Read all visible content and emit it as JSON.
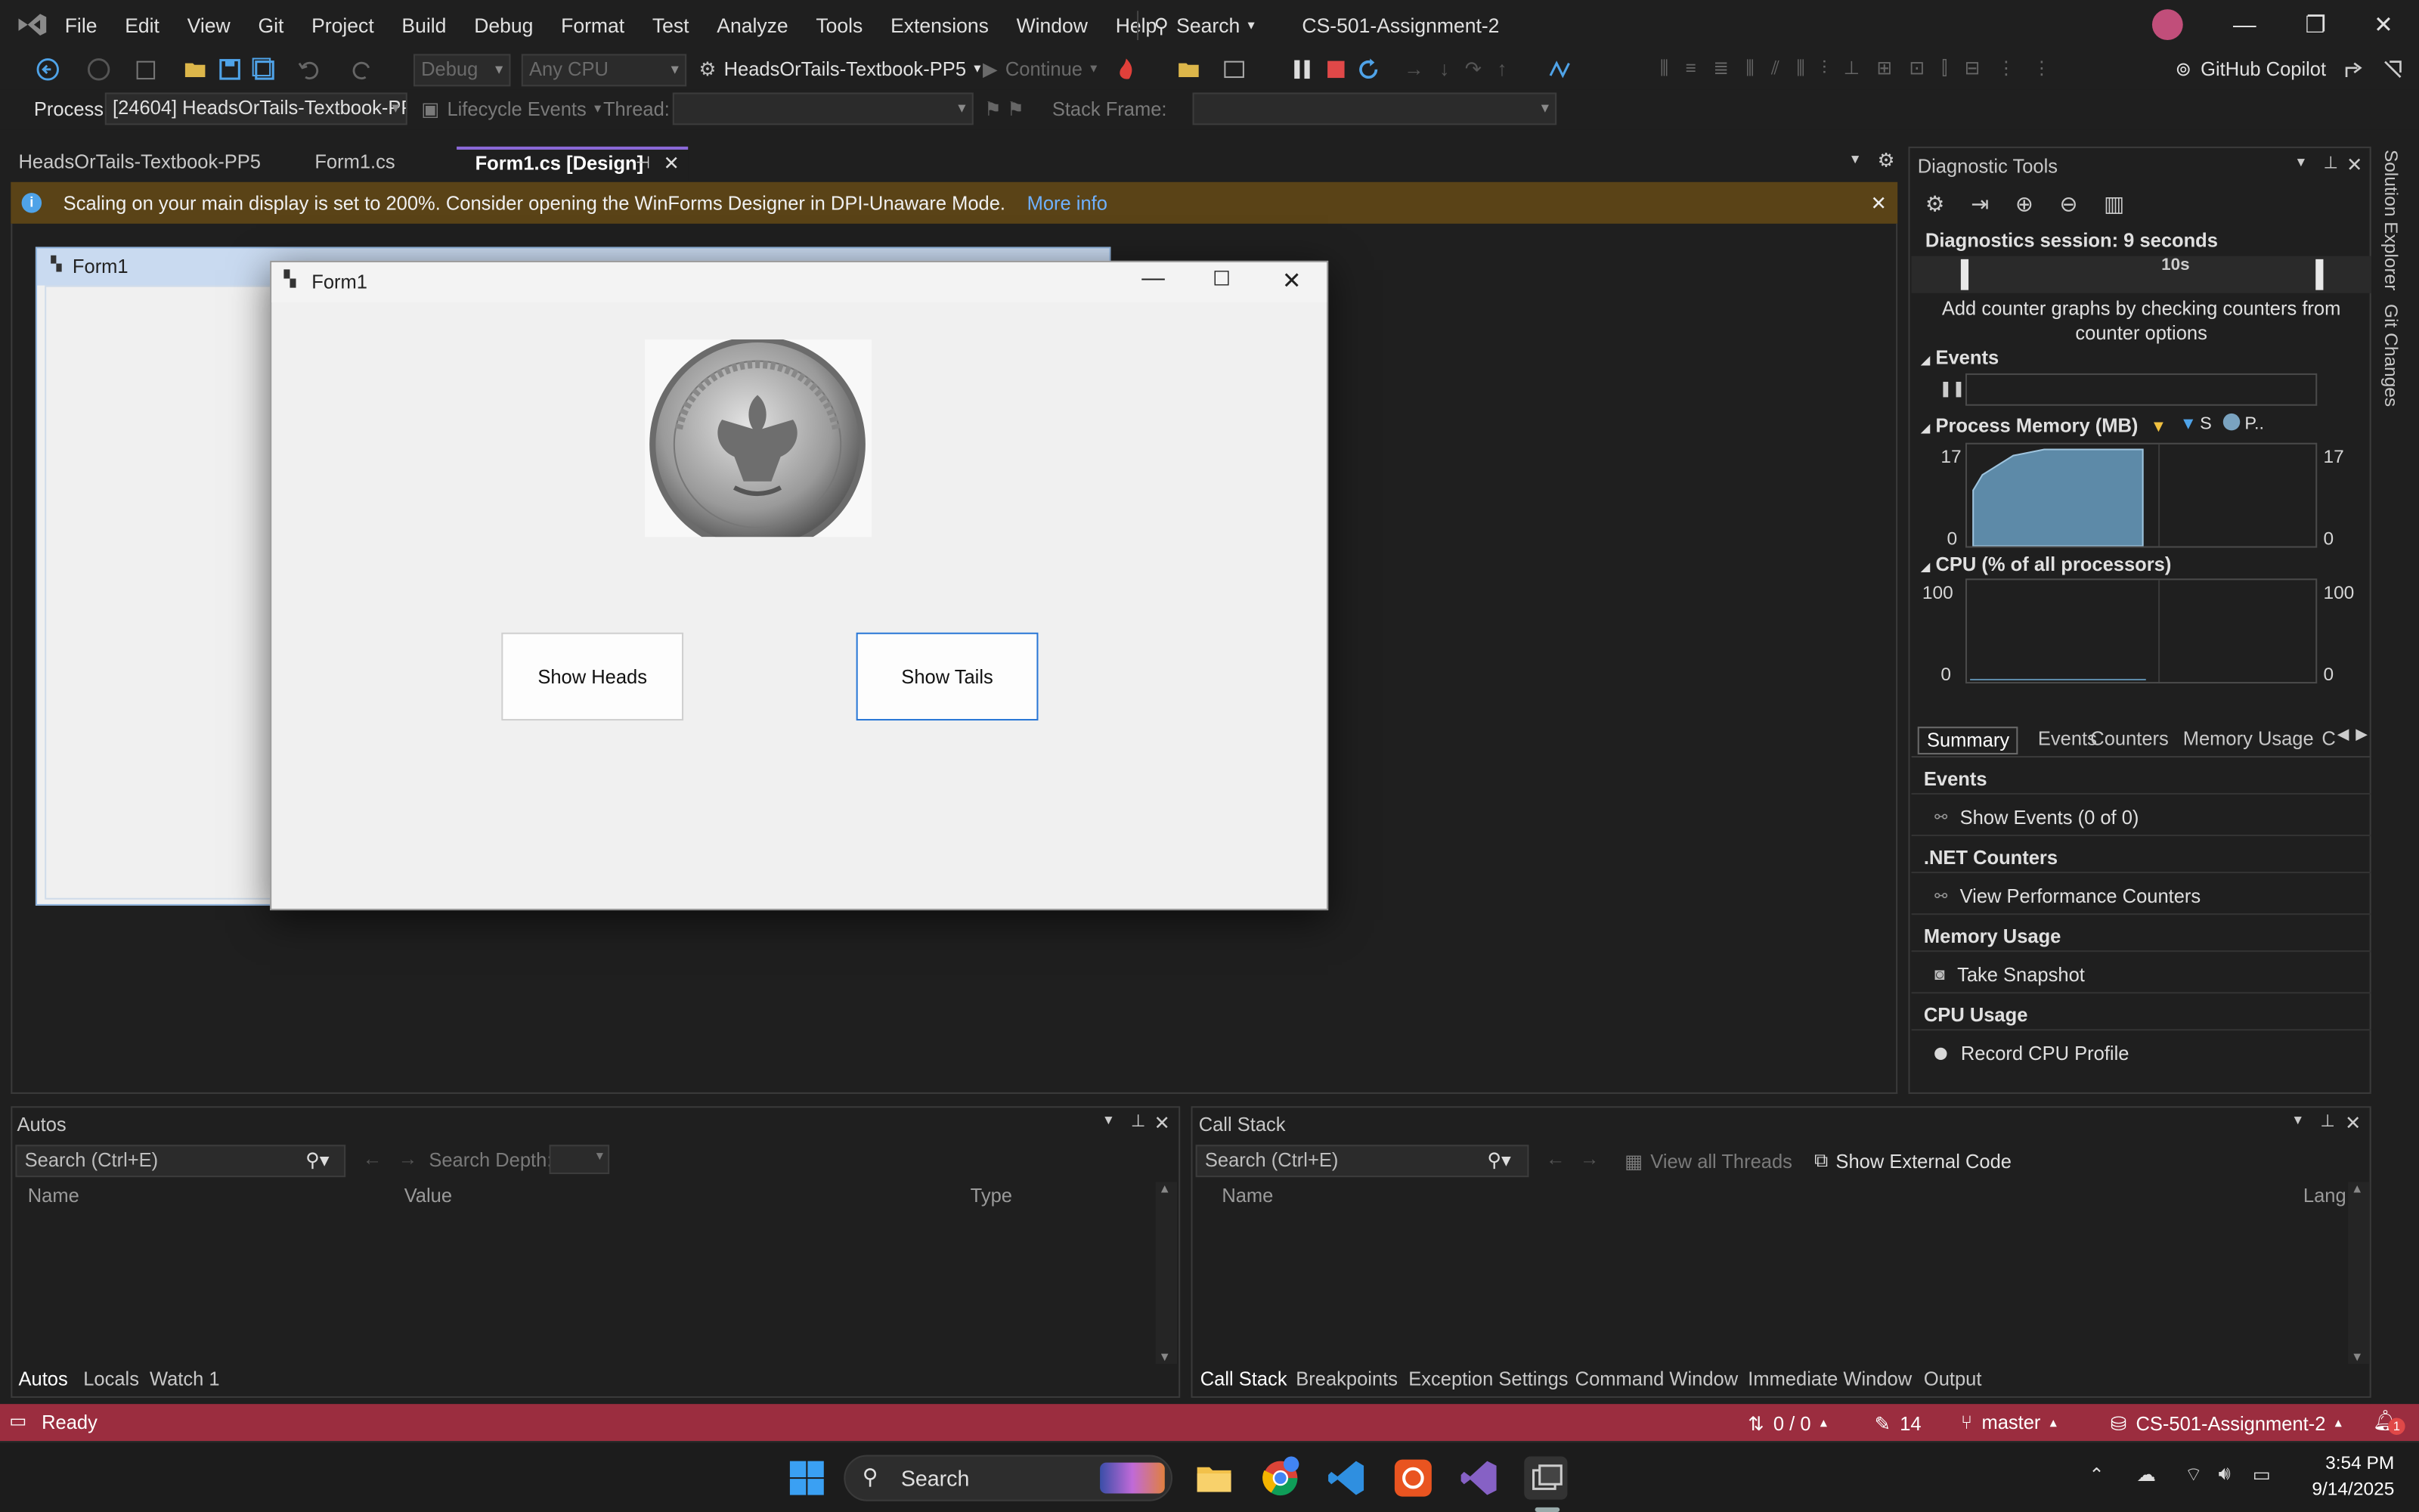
{
  "menubar": {
    "items": [
      "File",
      "Edit",
      "View",
      "Git",
      "Project",
      "Build",
      "Debug",
      "Format",
      "Test",
      "Analyze",
      "Tools",
      "Extensions",
      "Window",
      "Help"
    ],
    "search_label": "Search",
    "solution_title": "CS-501-Assignment-2"
  },
  "toolbar": {
    "config": "Debug",
    "platform": "Any CPU",
    "startup_project": "HeadsOrTails-Textbook-PP5",
    "continue_label": "Continue",
    "copilot_label": "GitHub Copilot"
  },
  "procbar": {
    "process_label": "Process:",
    "process_value": "[24604] HeadsOrTails-Textbook-PP",
    "lifecycle_label": "Lifecycle Events",
    "thread_label": "Thread:",
    "stackframe_label": "Stack Frame:"
  },
  "doc_tabs": [
    "HeadsOrTails-Textbook-PP5",
    "Form1.cs",
    "Form1.cs [Design]"
  ],
  "infobar": {
    "message": "Scaling on your main display is set to 200%. Consider opening the WinForms Designer in DPI-Unaware Mode.",
    "link": "More info"
  },
  "designer": {
    "back_form_title": "Form1",
    "form_title": "Form1",
    "coin_lettering": [
      "UNITED STATES OF AMERICA",
      "E PLURIBUS UNUM",
      "QUARTER DOLLAR"
    ],
    "buttons": {
      "heads": "Show Heads",
      "tails": "Show Tails"
    }
  },
  "diag": {
    "title": "Diagnostic Tools",
    "session": "Diagnostics session: 9 seconds",
    "timeline_label": "10s",
    "counter_hint": "Add counter graphs by checking counters from counter options",
    "events_title": "Events",
    "memory_title": "Process Memory (MB)",
    "memory_legend": [
      "S",
      "P.."
    ],
    "memory_max": "17",
    "memory_min": "0",
    "memory_fill": 0.95,
    "cpu_title": "CPU (% of all processors)",
    "cpu_max": "100",
    "cpu_min": "0",
    "tabs": [
      "Summary",
      "Events",
      "Counters",
      "Memory Usage",
      "C"
    ],
    "sections": [
      {
        "title": "Events",
        "link": "Show Events (0 of 0)"
      },
      {
        "title": ".NET Counters",
        "link": "View Performance Counters"
      },
      {
        "title": "Memory Usage",
        "link": "Take Snapshot"
      },
      {
        "title": "CPU Usage",
        "link": "Record CPU Profile"
      }
    ]
  },
  "side_tabs": [
    "Solution Explorer",
    "Git Changes"
  ],
  "autos": {
    "title": "Autos",
    "search_placeholder": "Search (Ctrl+E)",
    "depth_label": "Search Depth:",
    "columns": [
      "Name",
      "Value",
      "Type"
    ],
    "tabs": [
      "Autos",
      "Locals",
      "Watch 1"
    ]
  },
  "callstack": {
    "title": "Call Stack",
    "search_placeholder": "Search (Ctrl+E)",
    "view_threads": "View all Threads",
    "external_code": "Show External Code",
    "columns": [
      "Name",
      "Lang"
    ],
    "tabs": [
      "Call Stack",
      "Breakpoints",
      "Exception Settings",
      "Command Window",
      "Immediate Window",
      "Output"
    ]
  },
  "status": {
    "ready": "Ready",
    "sync": "0 / 0",
    "edits": "14",
    "branch": "master",
    "repo": "CS-501-Assignment-2",
    "notifications": "1"
  },
  "taskbar": {
    "search_label": "Search",
    "time": "3:54 PM",
    "date": "9/14/2025"
  },
  "colors": {
    "accent": "#8b69d8",
    "status_bar": "#9b2d3f",
    "info_bar": "#5a4317"
  }
}
